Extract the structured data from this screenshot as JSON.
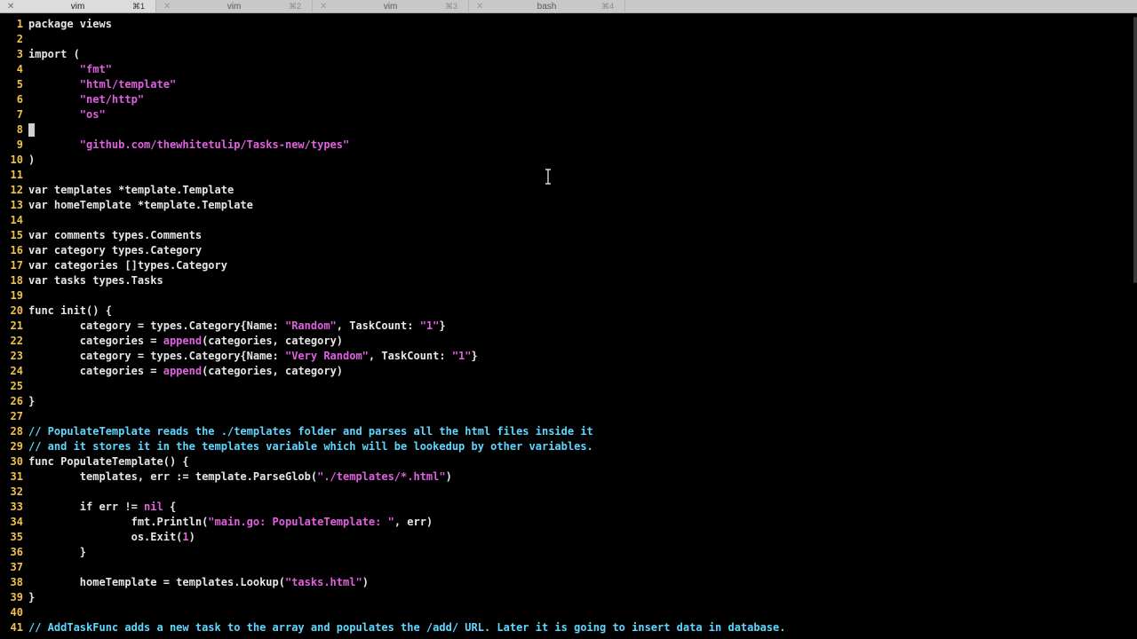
{
  "tabs": [
    {
      "label": "vim",
      "shortcut": "⌘1",
      "active": true
    },
    {
      "label": "vim",
      "shortcut": "⌘2",
      "active": false
    },
    {
      "label": "vim",
      "shortcut": "⌘3",
      "active": false
    },
    {
      "label": "bash",
      "shortcut": "⌘4",
      "active": false
    }
  ],
  "close_glyph": "✕",
  "lines": [
    {
      "n": "1",
      "parts": [
        [
          "kw",
          "package views"
        ]
      ]
    },
    {
      "n": "2",
      "parts": []
    },
    {
      "n": "3",
      "parts": [
        [
          "kw",
          "import ("
        ]
      ]
    },
    {
      "n": "4",
      "parts": [
        [
          "kw",
          "        "
        ],
        [
          "str",
          "\"fmt\""
        ]
      ]
    },
    {
      "n": "5",
      "parts": [
        [
          "kw",
          "        "
        ],
        [
          "str",
          "\"html/template\""
        ]
      ]
    },
    {
      "n": "6",
      "parts": [
        [
          "kw",
          "        "
        ],
        [
          "str",
          "\"net/http\""
        ]
      ]
    },
    {
      "n": "7",
      "parts": [
        [
          "kw",
          "        "
        ],
        [
          "str",
          "\"os\""
        ]
      ]
    },
    {
      "n": "8",
      "parts": [
        [
          "cursor",
          ""
        ]
      ]
    },
    {
      "n": "9",
      "parts": [
        [
          "kw",
          "        "
        ],
        [
          "str",
          "\"github.com/thewhitetulip/Tasks-new/types\""
        ]
      ]
    },
    {
      "n": "10",
      "parts": [
        [
          "kw",
          ")"
        ]
      ]
    },
    {
      "n": "11",
      "parts": []
    },
    {
      "n": "12",
      "parts": [
        [
          "kw",
          "var templates *template.Template"
        ]
      ]
    },
    {
      "n": "13",
      "parts": [
        [
          "kw",
          "var homeTemplate *template.Template"
        ]
      ]
    },
    {
      "n": "14",
      "parts": []
    },
    {
      "n": "15",
      "parts": [
        [
          "kw",
          "var comments types.Comments"
        ]
      ]
    },
    {
      "n": "16",
      "parts": [
        [
          "kw",
          "var category types.Category"
        ]
      ]
    },
    {
      "n": "17",
      "parts": [
        [
          "kw",
          "var categories []types.Category"
        ]
      ]
    },
    {
      "n": "18",
      "parts": [
        [
          "kw",
          "var tasks types.Tasks"
        ]
      ]
    },
    {
      "n": "19",
      "parts": []
    },
    {
      "n": "20",
      "parts": [
        [
          "kw",
          "func init() {"
        ]
      ]
    },
    {
      "n": "21",
      "parts": [
        [
          "kw",
          "        category = types.Category{Name: "
        ],
        [
          "str",
          "\"Random\""
        ],
        [
          "kw",
          ", TaskCount: "
        ],
        [
          "str",
          "\"1\""
        ],
        [
          "kw",
          "}"
        ]
      ]
    },
    {
      "n": "22",
      "parts": [
        [
          "kw",
          "        categories = "
        ],
        [
          "builtin",
          "append"
        ],
        [
          "kw",
          "(categories, category)"
        ]
      ]
    },
    {
      "n": "23",
      "parts": [
        [
          "kw",
          "        category = types.Category{Name: "
        ],
        [
          "str",
          "\"Very Random\""
        ],
        [
          "kw",
          ", TaskCount: "
        ],
        [
          "str",
          "\"1\""
        ],
        [
          "kw",
          "}"
        ]
      ]
    },
    {
      "n": "24",
      "parts": [
        [
          "kw",
          "        categories = "
        ],
        [
          "builtin",
          "append"
        ],
        [
          "kw",
          "(categories, category)"
        ]
      ]
    },
    {
      "n": "25",
      "parts": []
    },
    {
      "n": "26",
      "parts": [
        [
          "kw",
          "}"
        ]
      ]
    },
    {
      "n": "27",
      "parts": []
    },
    {
      "n": "28",
      "parts": [
        [
          "cmt",
          "// PopulateTemplate reads the ./templates folder and parses all the html files inside it"
        ]
      ]
    },
    {
      "n": "29",
      "parts": [
        [
          "cmt",
          "// and it stores it in the templates variable which will be lookedup by other variables."
        ]
      ]
    },
    {
      "n": "30",
      "parts": [
        [
          "kw",
          "func PopulateTemplate() {"
        ]
      ]
    },
    {
      "n": "31",
      "parts": [
        [
          "kw",
          "        templates, err := template.ParseGlob("
        ],
        [
          "str",
          "\"./templates/*.html\""
        ],
        [
          "kw",
          ")"
        ]
      ]
    },
    {
      "n": "32",
      "parts": []
    },
    {
      "n": "33",
      "parts": [
        [
          "kw",
          "        if err != "
        ],
        [
          "builtin",
          "nil"
        ],
        [
          "kw",
          " {"
        ]
      ]
    },
    {
      "n": "34",
      "parts": [
        [
          "kw",
          "                fmt.Println("
        ],
        [
          "str",
          "\"main.go: PopulateTemplate: \""
        ],
        [
          "kw",
          ", err)"
        ]
      ]
    },
    {
      "n": "35",
      "parts": [
        [
          "kw",
          "                os.Exit("
        ],
        [
          "str",
          "1"
        ],
        [
          "kw",
          ")"
        ]
      ]
    },
    {
      "n": "36",
      "parts": [
        [
          "kw",
          "        }"
        ]
      ]
    },
    {
      "n": "37",
      "parts": []
    },
    {
      "n": "38",
      "parts": [
        [
          "kw",
          "        homeTemplate = templates.Lookup("
        ],
        [
          "str",
          "\"tasks.html\""
        ],
        [
          "kw",
          ")"
        ]
      ]
    },
    {
      "n": "39",
      "parts": [
        [
          "kw",
          "}"
        ]
      ]
    },
    {
      "n": "40",
      "parts": []
    },
    {
      "n": "41",
      "parts": [
        [
          "cmt",
          "// AddTaskFunc adds a new task to the array and populates the /add/ URL. Later it is going to insert data in database."
        ]
      ]
    }
  ]
}
